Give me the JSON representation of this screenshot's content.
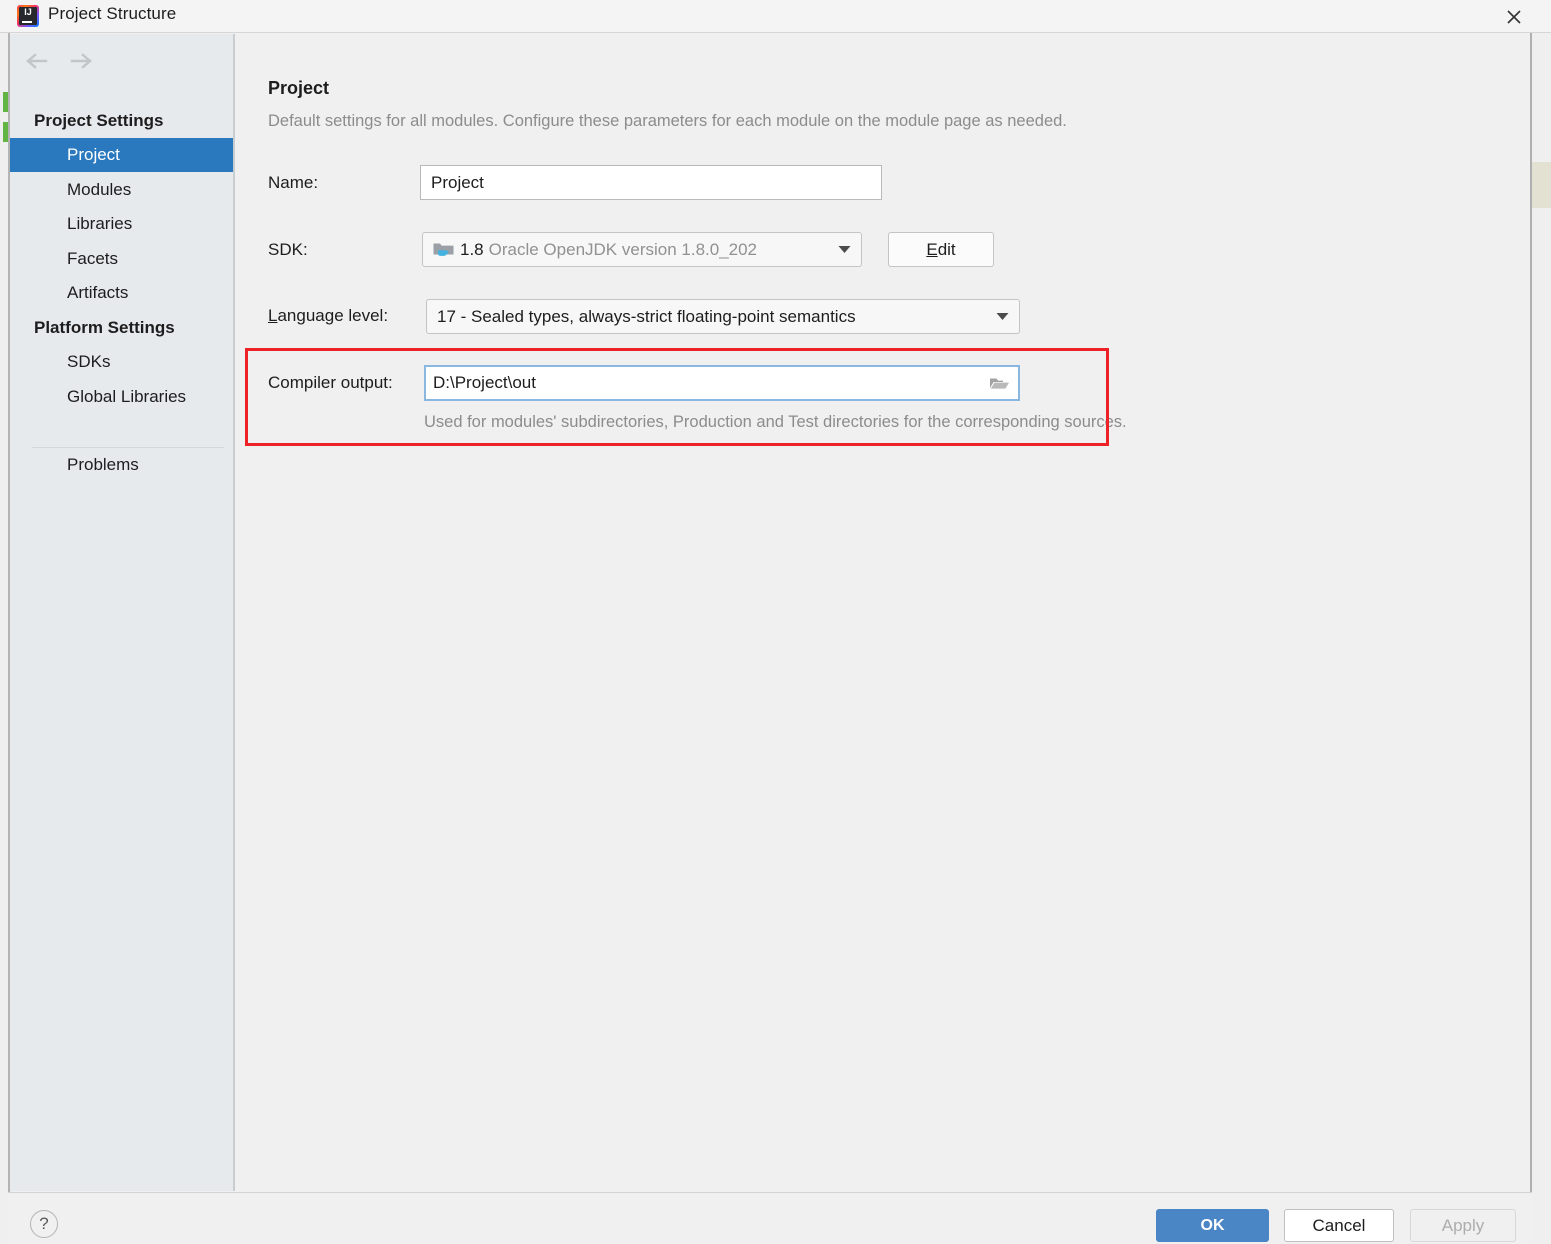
{
  "window": {
    "title": "Project Structure",
    "app_icon": "intellij-idea-icon",
    "close_icon": "close-icon"
  },
  "sidebar": {
    "nav": {
      "back_icon": "arrow-left-icon",
      "forward_icon": "arrow-right-icon"
    },
    "groups": [
      {
        "label": "Project Settings",
        "items": [
          {
            "label": "Project",
            "selected": true
          },
          {
            "label": "Modules",
            "selected": false
          },
          {
            "label": "Libraries",
            "selected": false
          },
          {
            "label": "Facets",
            "selected": false
          },
          {
            "label": "Artifacts",
            "selected": false
          }
        ]
      },
      {
        "label": "Platform Settings",
        "items": [
          {
            "label": "SDKs",
            "selected": false
          },
          {
            "label": "Global Libraries",
            "selected": false
          }
        ]
      }
    ],
    "extra_items": [
      {
        "label": "Problems",
        "selected": false
      }
    ]
  },
  "main": {
    "title": "Project",
    "description": "Default settings for all modules. Configure these parameters for each module on the module page as needed.",
    "fields": {
      "name": {
        "label": "Name:",
        "value": "Project"
      },
      "sdk": {
        "label": "SDK:",
        "value_version": "1.8",
        "value_detail": "Oracle OpenJDK version 1.8.0_202",
        "icon": "jdk-folder-icon",
        "dropdown_icon": "chevron-down-icon",
        "edit_button": "Edit",
        "edit_mnemonic": "E"
      },
      "language_level": {
        "label": "Language level:",
        "label_mnemonic": "L",
        "value": "17 - Sealed types, always-strict floating-point semantics",
        "dropdown_icon": "chevron-down-icon"
      },
      "compiler_output": {
        "label": "Compiler output:",
        "value": "D:\\Project\\out",
        "browse_icon": "folder-open-icon",
        "hint": "Used for modules' subdirectories, Production and Test directories for the corresponding sources."
      }
    }
  },
  "annotation": {
    "color": "#ec2227",
    "target": "compiler-output-row"
  },
  "footer": {
    "help_label": "?",
    "help_icon": "question-mark-icon",
    "ok_label": "OK",
    "cancel_label": "Cancel",
    "apply_label": "Apply",
    "apply_enabled": false
  },
  "colors": {
    "selection_blue": "#2a79bf",
    "sidebar_bg": "#e6eaed",
    "panel_bg": "#f0f0f0",
    "ok_blue": "#4a86c5",
    "focus_border": "#8ab7e0",
    "hint_gray": "#8c8c8c",
    "marker_green": "#62b543"
  }
}
